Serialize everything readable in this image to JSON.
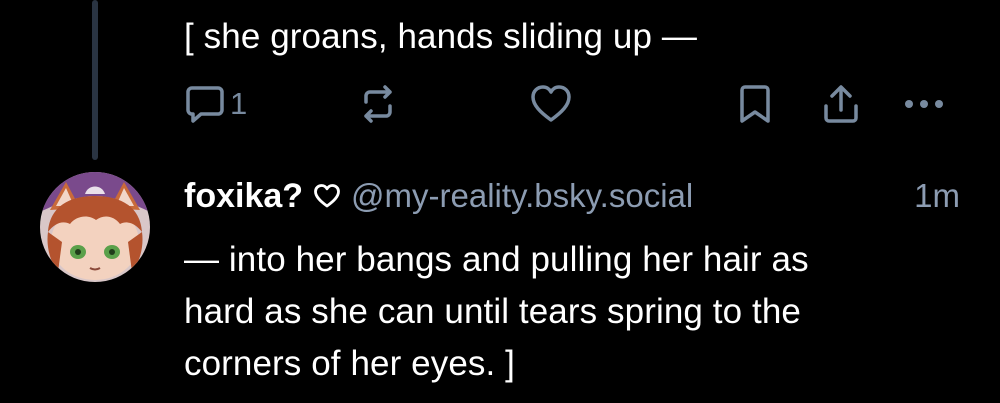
{
  "previous_post": {
    "text": "[ she groans, hands sliding up —",
    "reply_count": "1"
  },
  "post": {
    "display_name": "foxika?",
    "handle": "@my-reality.bsky.social",
    "timestamp": "1m",
    "lines": [
      "— into her bangs and pulling her hair as",
      "hard as she can until tears spring to the",
      "corners of her eyes. ]"
    ]
  },
  "icons": {
    "reply": "reply-bubble-icon",
    "repost": "repost-icon",
    "like": "heart-icon",
    "bookmark": "bookmark-icon",
    "share": "share-icon",
    "more": "more-icon",
    "badge": "heart-outline-icon"
  },
  "colors": {
    "background": "#000000",
    "text": "#ffffff",
    "muted": "#8c9cb2",
    "icon": "#788a9f",
    "thread_line": "#2a3442"
  }
}
